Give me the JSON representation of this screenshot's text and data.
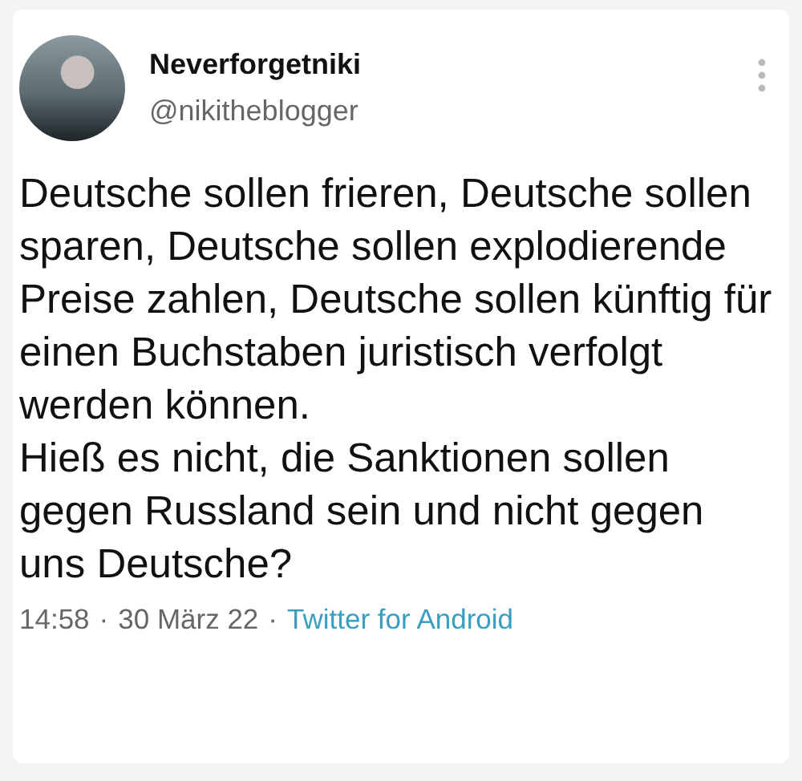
{
  "tweet": {
    "author": {
      "name": "Neverforgetniki",
      "handle": "@nikitheblogger"
    },
    "paragraphs": [
      "Deutsche sollen frieren, Deutsche sollen sparen, Deutsche sollen explodierende Preise zahlen, Deutsche sollen künftig für einen Buchstaben juristisch verfolgt werden können.",
      "Hieß es nicht, die Sanktionen sollen gegen Russland sein und nicht gegen uns Deutsche?"
    ],
    "time": "14:58",
    "separator_1": "·",
    "date": "30 März 22",
    "separator_2": "·",
    "source": "Twitter for Android"
  }
}
